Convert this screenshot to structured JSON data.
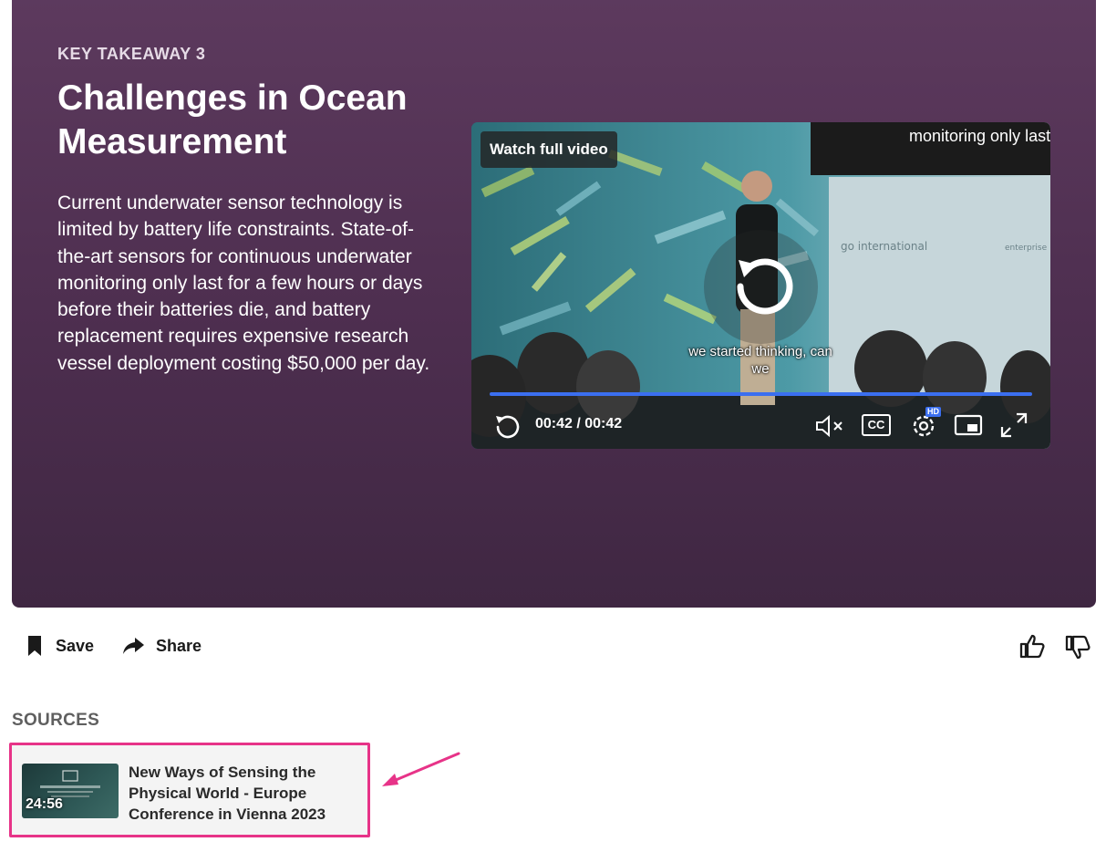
{
  "hero": {
    "kicker": "KEY TAKEAWAY 3",
    "title": "Challenges in Ocean Measurement",
    "body": "Current underwater sensor technology is limited by battery life constraints. State-of-the-art sensors for continuous underwater monitoring only last for a few hours or days before their batteries die, and battery replacement requires expensive research vessel deployment costing $50,000 per day."
  },
  "video": {
    "watch_label": "Watch full video",
    "top_caption": "monitoring only last",
    "subtitle": "we started thinking, can we",
    "time": "00:42 / 00:42",
    "progress": 1.0,
    "hd_badge": "HD",
    "cc_label": "CC",
    "controls": [
      "replay-icon",
      "mute-icon",
      "cc-icon",
      "settings-icon",
      "pip-icon",
      "fullscreen-icon"
    ]
  },
  "actions": {
    "save_label": "Save",
    "share_label": "Share"
  },
  "sources": {
    "label": "SOURCES",
    "items": [
      {
        "title": "New Ways of Sensing the Physical World - Europe Conference in Vienna 2023",
        "duration": "24:56"
      }
    ]
  },
  "colors": {
    "hero_bg": "#553557",
    "progress": "#3b6ff0",
    "highlight": "#e73388"
  }
}
